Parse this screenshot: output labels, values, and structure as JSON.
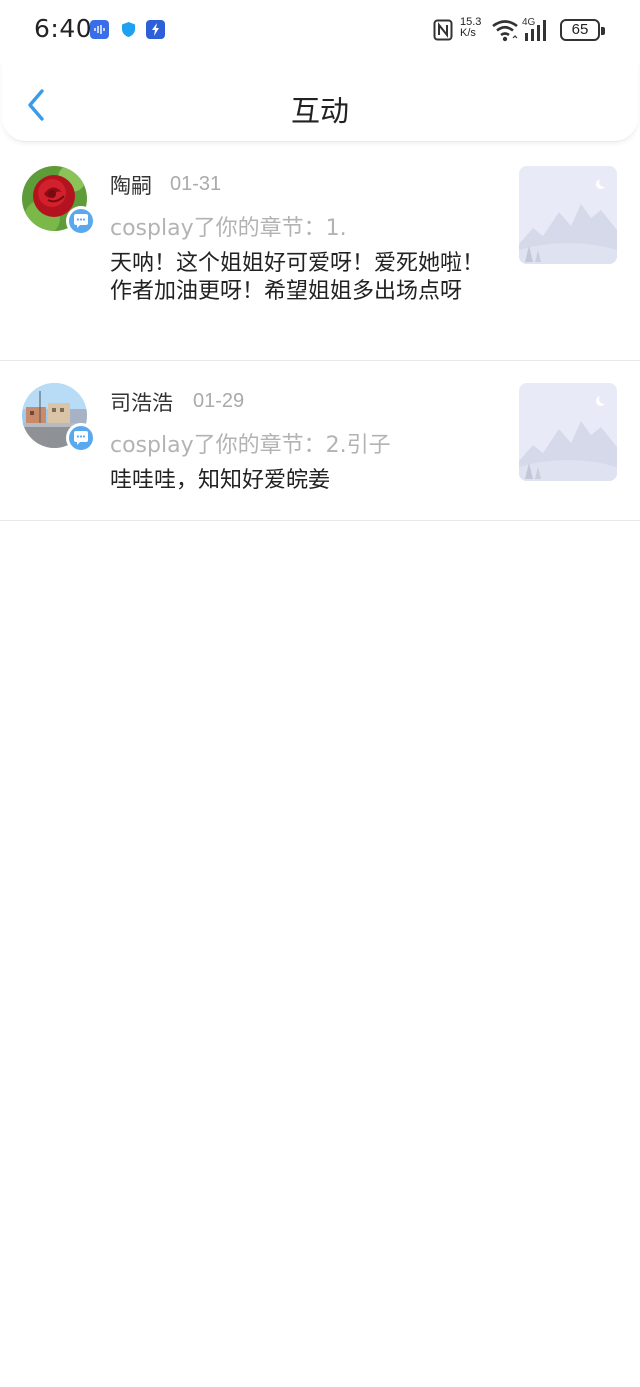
{
  "status_bar": {
    "time": "6:40",
    "net_speed_value": "15.3",
    "net_speed_unit": "K/s",
    "network_type": "4G",
    "battery": "65"
  },
  "header": {
    "title": "互动"
  },
  "items": [
    {
      "name": "陶嗣",
      "date": "01-31",
      "subline": "cosplay了你的章节：1.",
      "comment": "天呐！这个姐姐好可爱呀！爱死她啦！作者加油更呀！希望姐姐多出场点呀"
    },
    {
      "name": "司浩浩",
      "date": "01-29",
      "subline": "cosplay了你的章节：2.引子",
      "comment": "哇哇哇，知知好爱皖姜"
    }
  ],
  "colors": {
    "accent": "#3a9be8",
    "badge": "#5aa9ee",
    "muted_text": "#b3b3b3"
  }
}
